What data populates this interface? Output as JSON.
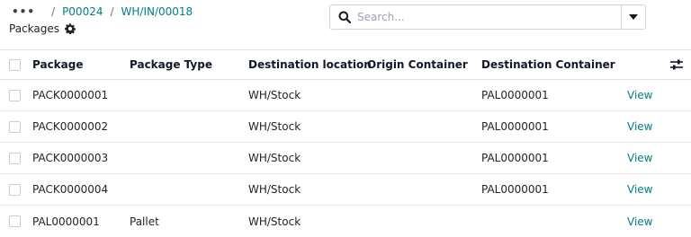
{
  "breadcrumb": {
    "more": "...",
    "separator": "/",
    "items": [
      "P00024",
      "WH/IN/00018"
    ]
  },
  "page": {
    "title": "Packages"
  },
  "search": {
    "placeholder": "Search...",
    "value": ""
  },
  "table": {
    "columns": [
      "Package",
      "Package Type",
      "Destination location",
      "Origin Container",
      "Destination Container"
    ],
    "rows": [
      {
        "package": "PACK0000001",
        "package_type": "",
        "destination_location": "WH/Stock",
        "origin_container": "",
        "destination_container": "PAL0000001",
        "action": "View"
      },
      {
        "package": "PACK0000002",
        "package_type": "",
        "destination_location": "WH/Stock",
        "origin_container": "",
        "destination_container": "PAL0000001",
        "action": "View"
      },
      {
        "package": "PACK0000003",
        "package_type": "",
        "destination_location": "WH/Stock",
        "origin_container": "",
        "destination_container": "PAL0000001",
        "action": "View"
      },
      {
        "package": "PACK0000004",
        "package_type": "",
        "destination_location": "WH/Stock",
        "origin_container": "",
        "destination_container": "PAL0000001",
        "action": "View"
      },
      {
        "package": "PAL0000001",
        "package_type": "Pallet",
        "destination_location": "WH/Stock",
        "origin_container": "",
        "destination_container": "",
        "action": "View"
      }
    ]
  },
  "icons": {
    "search": "search-icon",
    "dropdown": "caret-down-icon",
    "settings": "gear-icon",
    "optional_columns": "sliders-icon"
  },
  "colors": {
    "link": "#017e84",
    "text": "#212529",
    "border": "#dee2e6"
  }
}
